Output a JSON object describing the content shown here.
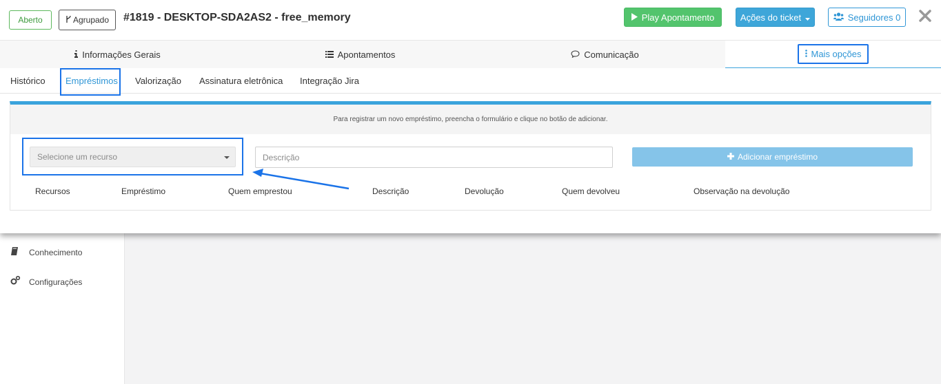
{
  "header": {
    "status_badge": "Aberto",
    "grouped_badge": "Agrupado",
    "title": "#1819 - DESKTOP-SDA2AS2 - free_memory",
    "play_label": "Play Apontamento",
    "actions_label": "Ações do ticket",
    "followers_label": "Seguidores 0"
  },
  "main_tabs": [
    {
      "label": "Informações Gerais",
      "icon": "info-icon"
    },
    {
      "label": "Apontamentos",
      "icon": "list-icon"
    },
    {
      "label": "Comunicação",
      "icon": "comment-icon"
    },
    {
      "label": "Mais opções",
      "icon": "vertical-ellipsis-icon"
    }
  ],
  "sub_tabs": [
    {
      "label": "Histórico"
    },
    {
      "label": "Empréstimos"
    },
    {
      "label": "Valorização"
    },
    {
      "label": "Assinatura eletrônica"
    },
    {
      "label": "Integração Jira"
    }
  ],
  "loans": {
    "info_text": "Para registrar um novo empréstimo, preencha o formulário e clique no botão de adicionar.",
    "resource_placeholder": "Selecione um recurso",
    "description_placeholder": "Descrição",
    "add_label": "Adicionar empréstimo",
    "columns": [
      "Recursos",
      "Empréstimo",
      "Quem emprestou",
      "Descrição",
      "Devolução",
      "Quem devolveu",
      "Observação na devolução"
    ]
  },
  "background_sidebar": [
    {
      "label": "Conhecimento",
      "icon": "book-icon"
    },
    {
      "label": "Configurações",
      "icon": "gears-icon"
    }
  ],
  "colors": {
    "accent": "#3aa3dc",
    "success": "#53c46d",
    "highlight": "#1a73e8",
    "add_button": "#85c4e9"
  }
}
